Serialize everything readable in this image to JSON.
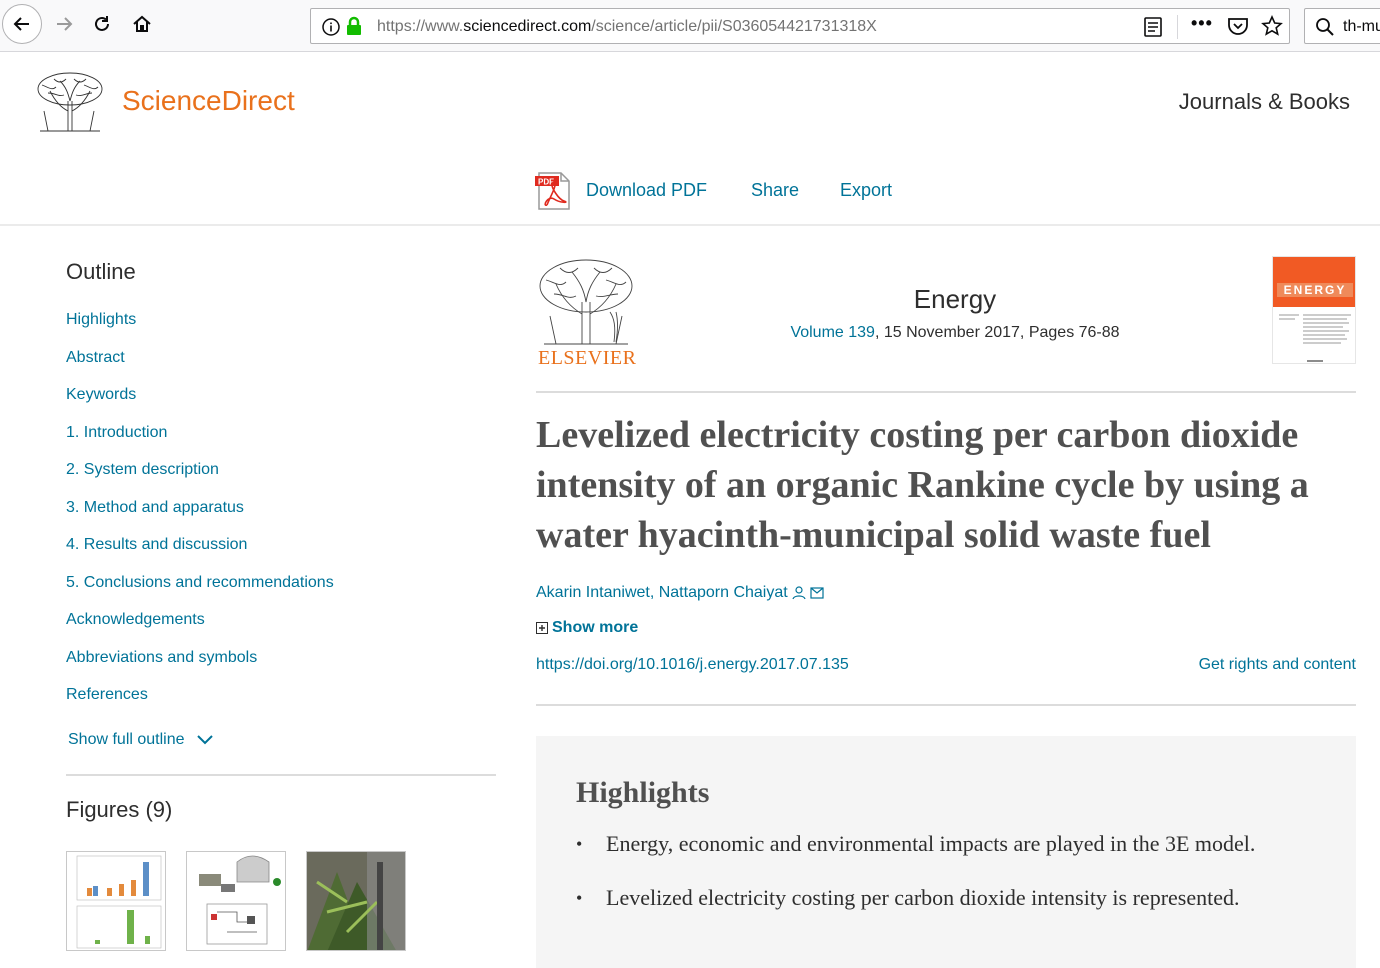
{
  "browser": {
    "url_prefix": "https://www.",
    "url_domain": "sciencedirect.com",
    "url_path": "/science/article/pii/S036054421731318X",
    "more_label": "•••",
    "search_text": "th-mu"
  },
  "header": {
    "brand": "ScienceDirect",
    "journals_link": "Journals & Books"
  },
  "toolbar": {
    "download_pdf": "Download PDF",
    "share": "Share",
    "export": "Export"
  },
  "outline": {
    "title": "Outline",
    "items": [
      "Highlights",
      "Abstract",
      "Keywords",
      "1. Introduction",
      "2. System description",
      "3. Method and apparatus",
      "4. Results and discussion",
      "5. Conclusions and recommendations",
      "Acknowledgements",
      "Abbreviations and symbols",
      "References"
    ],
    "show_full": "Show full outline"
  },
  "figures": {
    "title": "Figures (9)"
  },
  "article": {
    "publisher": "ELSEVIER",
    "journal": "Energy",
    "volume": "Volume 139",
    "meta_rest": ", 15 November 2017, Pages 76-88",
    "title": "Levelized electricity costing per carbon dioxide intensity of an organic Rankine cycle by using a water hyacinth-municipal solid waste fuel",
    "authors": "Akarin Intaniwet, Nattaporn Chaiyat",
    "show_more": "Show more",
    "doi": "https://doi.org/10.1016/j.energy.2017.07.135",
    "rights": "Get rights and content",
    "cover_title": "ENERGY"
  },
  "highlights": {
    "title": "Highlights",
    "items": [
      "Energy, economic and environmental impacts are played in the 3E model.",
      "Levelized electricity costing per carbon dioxide intensity is represented."
    ]
  },
  "colors": {
    "brand_orange": "#e9711c",
    "link_teal": "#007398",
    "text_dark": "#2e2e2e"
  }
}
